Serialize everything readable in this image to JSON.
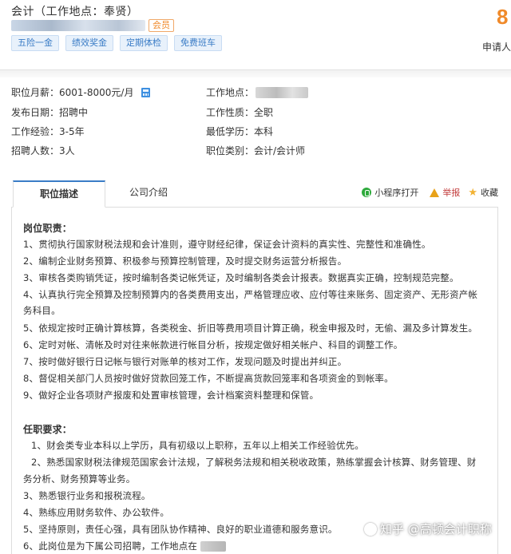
{
  "header": {
    "job_title": "会计（工作地点：奉贤）",
    "member_badge": "会员",
    "tags": [
      "五险一金",
      "绩效奖金",
      "定期体检",
      "免费班车"
    ],
    "applicant_count": "8",
    "applicant_label": "申请人"
  },
  "info": {
    "salary": "职位月薪：6001-8000元/月",
    "location_label": "工作地点：",
    "publish_date": "发布日期：招聘中",
    "job_nature": "工作性质：全职",
    "experience": "工作经验：3-5年",
    "education": "最低学历：本科",
    "headcount": "招聘人数：3人",
    "category": "职位类别：会计/会计师"
  },
  "tabs": {
    "active": "职位描述",
    "other": "公司介绍",
    "mini_program": "小程序打开",
    "report": "举报",
    "favorite": "收藏"
  },
  "description": {
    "duties_heading": "岗位职责：",
    "duties": [
      "1、贯彻执行国家财税法规和会计准则，遵守财经纪律，保证会计资料的真实性、完整性和准确性。",
      "2、编制企业财务预算、积极参与预算控制管理，及时提交财务运营分析报告。",
      "3、审核各类购销凭证，按时编制各类记帐凭证，及时编制各类会计报表。数据真实正确，控制规范完整。",
      "4、认真执行完全预算及控制预算内的各类费用支出，严格管理应收、应付等往来账务、固定资产、无形资产帐",
      "务科目。",
      "5、依规定按时正确计算核算，各类税金、折旧等费用项目计算正确，税金申报及时，无偷、漏及多计算发生。",
      "6、定时对帐、清帐及时对往来帐款进行帐目分析，按规定做好相关帐户、科目的调整工作。",
      "7、按时做好银行日记帐与银行对账单的核对工作，发现问题及时提出并纠正。",
      "8、督促相关部门人员按时做好贷款回笼工作，不断提高货款回笼率和各项资金的到帐率。",
      "9、做好企业各项财产报废和处置审核管理，会计档案资料整理和保管。"
    ],
    "requirements_heading": "任职要求：",
    "requirements": [
      "1、财会类专业本科以上学历，具有初级以上职称，五年以上相关工作经验优先。",
      "2、熟悉国家财税法律规范国家会计法规，了解税务法规和相关税收政策，熟练掌握会计核算、财务管理、财",
      "务分析、财务预算等业务。",
      "3、熟悉银行业务和报税流程。",
      "4、熟练应用财务软件、办公软件。",
      "5、坚持原则，责任心强，具有团队协作精神、良好的职业道德和服务意识。",
      "6、此岗位是为下属公司招聘，工作地点在"
    ]
  },
  "watermark": "知乎 @高顿会计职称"
}
